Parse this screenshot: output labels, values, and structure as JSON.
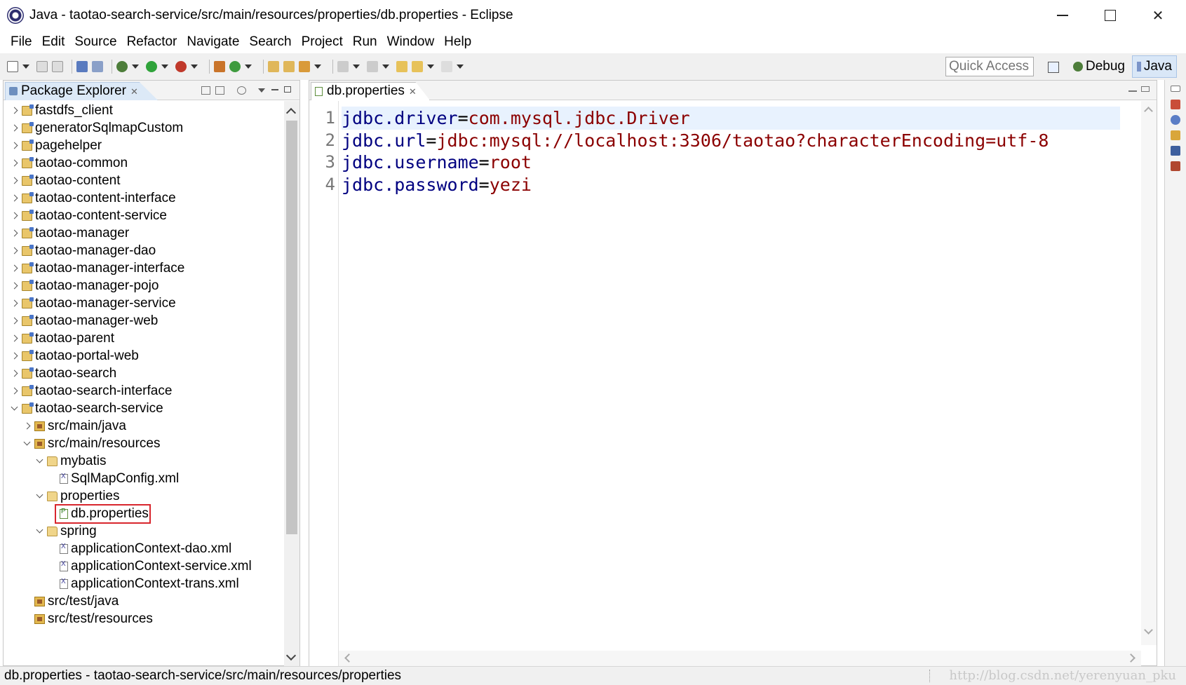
{
  "window": {
    "title": "Java - taotao-search-service/src/main/resources/properties/db.properties - Eclipse"
  },
  "menu": [
    "File",
    "Edit",
    "Source",
    "Refactor",
    "Navigate",
    "Search",
    "Project",
    "Run",
    "Window",
    "Help"
  ],
  "toolbar": {
    "quick_access_placeholder": "Quick Access",
    "perspective_debug": "Debug",
    "perspective_java": "Java"
  },
  "package_explorer": {
    "title": "Package Explorer",
    "tree": [
      {
        "label": "fastdfs_client",
        "level": 0,
        "twisty": "collapsed",
        "icon": "project-icon"
      },
      {
        "label": "generatorSqlmapCustom",
        "level": 0,
        "twisty": "collapsed",
        "icon": "project-icon"
      },
      {
        "label": "pagehelper",
        "level": 0,
        "twisty": "collapsed",
        "icon": "project-icon"
      },
      {
        "label": "taotao-common",
        "level": 0,
        "twisty": "collapsed",
        "icon": "project-icon"
      },
      {
        "label": "taotao-content",
        "level": 0,
        "twisty": "collapsed",
        "icon": "project-icon"
      },
      {
        "label": "taotao-content-interface",
        "level": 0,
        "twisty": "collapsed",
        "icon": "project-icon"
      },
      {
        "label": "taotao-content-service",
        "level": 0,
        "twisty": "collapsed",
        "icon": "project-icon"
      },
      {
        "label": "taotao-manager",
        "level": 0,
        "twisty": "collapsed",
        "icon": "project-icon"
      },
      {
        "label": "taotao-manager-dao",
        "level": 0,
        "twisty": "collapsed",
        "icon": "project-icon"
      },
      {
        "label": "taotao-manager-interface",
        "level": 0,
        "twisty": "collapsed",
        "icon": "project-icon"
      },
      {
        "label": "taotao-manager-pojo",
        "level": 0,
        "twisty": "collapsed",
        "icon": "project-icon"
      },
      {
        "label": "taotao-manager-service",
        "level": 0,
        "twisty": "collapsed",
        "icon": "project-icon"
      },
      {
        "label": "taotao-manager-web",
        "level": 0,
        "twisty": "collapsed",
        "icon": "project-icon"
      },
      {
        "label": "taotao-parent",
        "level": 0,
        "twisty": "collapsed",
        "icon": "project-icon"
      },
      {
        "label": "taotao-portal-web",
        "level": 0,
        "twisty": "collapsed",
        "icon": "project-icon"
      },
      {
        "label": "taotao-search",
        "level": 0,
        "twisty": "collapsed",
        "icon": "project-icon"
      },
      {
        "label": "taotao-search-interface",
        "level": 0,
        "twisty": "collapsed",
        "icon": "project-icon"
      },
      {
        "label": "taotao-search-service",
        "level": 0,
        "twisty": "expanded",
        "icon": "project-icon"
      },
      {
        "label": "src/main/java",
        "level": 1,
        "twisty": "collapsed",
        "icon": "source-folder-icon"
      },
      {
        "label": "src/main/resources",
        "level": 1,
        "twisty": "expanded",
        "icon": "source-folder-icon"
      },
      {
        "label": "mybatis",
        "level": 2,
        "twisty": "expanded",
        "icon": "folder-icon"
      },
      {
        "label": "SqlMapConfig.xml",
        "level": 3,
        "twisty": "none",
        "icon": "xml-file-icon"
      },
      {
        "label": "properties",
        "level": 2,
        "twisty": "expanded",
        "icon": "folder-icon"
      },
      {
        "label": "db.properties",
        "level": 3,
        "twisty": "none",
        "icon": "properties-file-icon",
        "selected": true
      },
      {
        "label": "spring",
        "level": 2,
        "twisty": "expanded",
        "icon": "folder-icon"
      },
      {
        "label": "applicationContext-dao.xml",
        "level": 3,
        "twisty": "none",
        "icon": "xml-file-icon"
      },
      {
        "label": "applicationContext-service.xml",
        "level": 3,
        "twisty": "none",
        "icon": "xml-file-icon"
      },
      {
        "label": "applicationContext-trans.xml",
        "level": 3,
        "twisty": "none",
        "icon": "xml-file-icon"
      },
      {
        "label": "src/test/java",
        "level": 1,
        "twisty": "none",
        "icon": "source-folder-icon"
      },
      {
        "label": "src/test/resources",
        "level": 1,
        "twisty": "none",
        "icon": "source-folder-icon"
      }
    ]
  },
  "editor": {
    "tab_label": "db.properties",
    "lines": [
      {
        "num": "1",
        "key": "jdbc.driver",
        "value": "com.mysql.jdbc.Driver"
      },
      {
        "num": "2",
        "key": "jdbc.url",
        "value": "jdbc:mysql://localhost:3306/taotao?characterEncoding=utf-8"
      },
      {
        "num": "3",
        "key": "jdbc.username",
        "value": "root"
      },
      {
        "num": "4",
        "key": "jdbc.password",
        "value": "yezi"
      }
    ]
  },
  "status": {
    "path": "db.properties - taotao-search-service/src/main/resources/properties",
    "watermark": "http://blog.csdn.net/yerenyuan_pku"
  },
  "colors": {
    "key": "#000080",
    "value": "#8b0000",
    "selection_outline": "#d8262d",
    "current_line": "#e8f2fe"
  }
}
